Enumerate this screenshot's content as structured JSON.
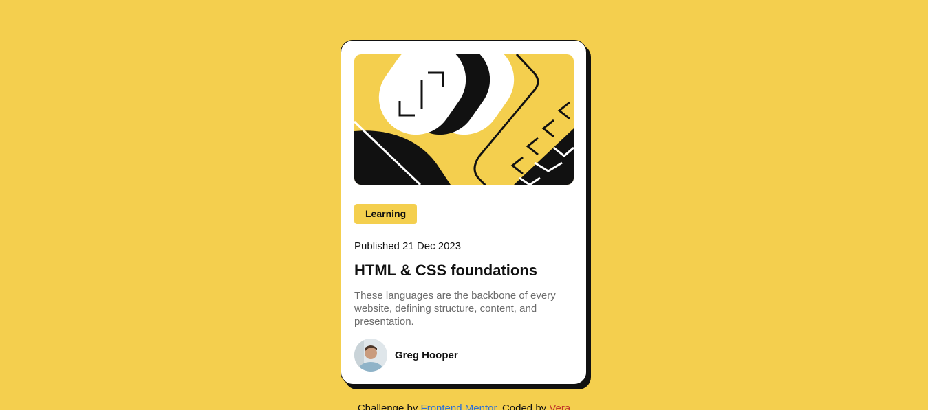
{
  "colors": {
    "background": "#F4CF4E",
    "card_bg": "#FFFFFF",
    "ink": "#111111",
    "muted_text": "#6B6B6B",
    "link_primary": "#2B6FD6",
    "link_secondary": "#C0392B"
  },
  "card": {
    "hero_image": "html-css-illustration",
    "tag": "Learning",
    "published": "Published 21 Dec 2023",
    "title": "HTML & CSS foundations",
    "description": "These languages are the backbone of every website, defining structure, content, and presentation.",
    "author": {
      "avatar": "avatar-photo",
      "name": "Greg Hooper"
    }
  },
  "attribution": {
    "prefix": "Challenge by",
    "link1": "Frontend Mentor",
    "middle": ". Coded by",
    "link2": "Vera"
  }
}
